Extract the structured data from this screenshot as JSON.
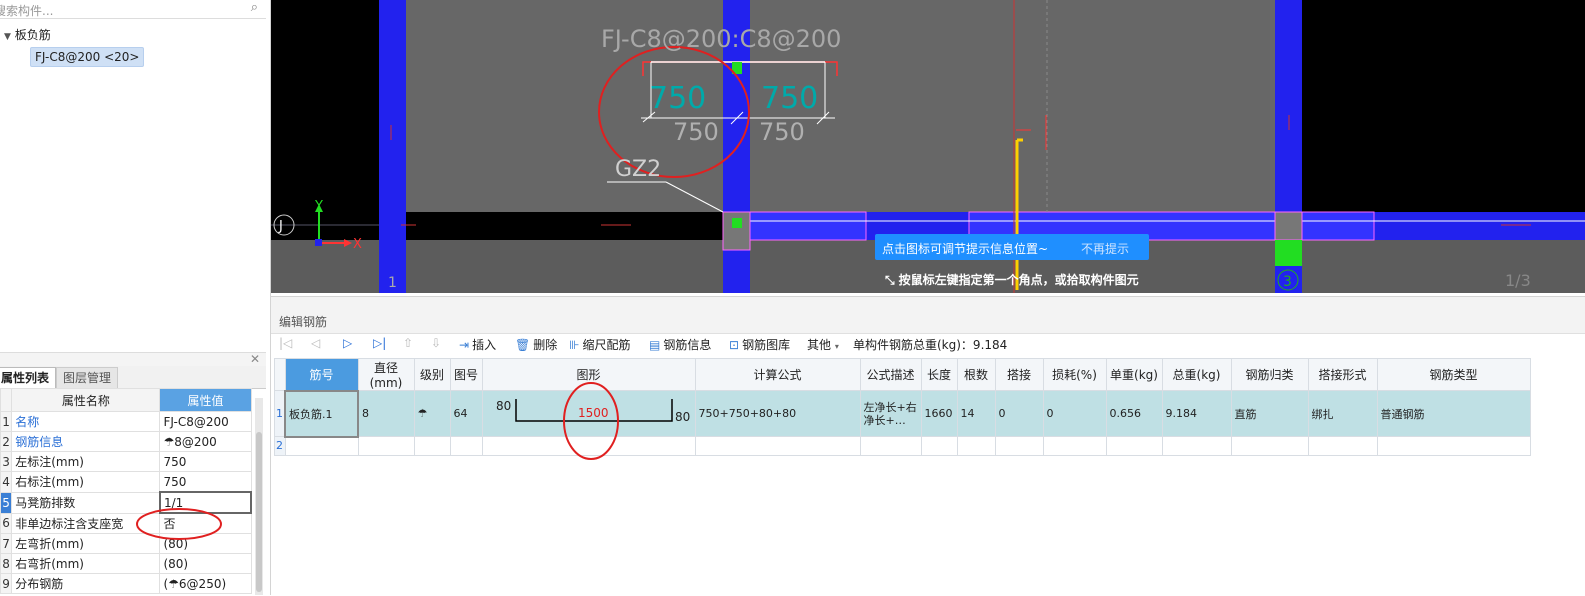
{
  "left_panel": {
    "search": {
      "placeholder": "搜索构件...",
      "icon": "search-icon"
    },
    "tree": {
      "root_label": "板负筋",
      "child_label": "FJ-C8@200 <20>"
    },
    "tabs": [
      "属性列表",
      "图层管理"
    ],
    "property_grid": {
      "headers": [
        "属性名称",
        "属性值"
      ],
      "rows": [
        {
          "num": "1",
          "name": "名称",
          "value": "FJ-C8@200"
        },
        {
          "num": "2",
          "name": "钢筋信息",
          "value": "☂8@200"
        },
        {
          "num": "3",
          "name": "左标注(mm)",
          "value": "750"
        },
        {
          "num": "4",
          "name": "右标注(mm)",
          "value": "750"
        },
        {
          "num": "5",
          "name": "马凳筋排数",
          "value": "1/1"
        },
        {
          "num": "6",
          "name": "非单边标注含支座宽",
          "value": "否"
        },
        {
          "num": "7",
          "name": "左弯折(mm)",
          "value": "(80)"
        },
        {
          "num": "8",
          "name": "右弯折(mm)",
          "value": "(80)"
        },
        {
          "num": "9",
          "name": "分布钢筋",
          "value": "(☂6@250)"
        }
      ]
    }
  },
  "cad": {
    "label_top": "FJ-C8@200:C8@200",
    "dim_left_cyan": "750",
    "dim_right_cyan": "750",
    "dim_left_white": "750",
    "dim_right_white": "750",
    "gz_label": "GZ2",
    "axis_j": "J",
    "axis_x": "X",
    "axis_y": "Y",
    "grid_1": "1",
    "grid_3": "3",
    "page_indicator": "1/3",
    "tip_message": "点击图标可调节提示信息位置~",
    "tip_dismiss": "不再提示",
    "command_prompt": "按鼠标左键指定第一个角点，或拾取构件图元"
  },
  "editor": {
    "title": "编辑钢筋",
    "toolbar": {
      "insert": "插入",
      "delete": "删除",
      "scale": "缩尺配筋",
      "info": "钢筋信息",
      "library": "钢筋图库",
      "other": "其他",
      "total_weight": "单构件钢筋总重(kg)：9.184"
    },
    "columns": [
      "筋号",
      "直径(mm)",
      "级别",
      "图号",
      "图形",
      "计算公式",
      "公式描述",
      "长度",
      "根数",
      "搭接",
      "损耗(%)",
      "单重(kg)",
      "总重(kg)",
      "钢筋归类",
      "搭接形式",
      "钢筋类型"
    ],
    "rows": [
      {
        "num": "1",
        "name": "板负筋.1",
        "diameter": "8",
        "grade": "☂",
        "fig_no": "64",
        "shape_left": "80",
        "shape_mid": "1500",
        "shape_right": "80",
        "formula": "750+750+80+80",
        "desc": "左净长+右净长+…",
        "length": "1660",
        "count": "14",
        "lap": "0",
        "loss": "0",
        "unit_weight": "0.656",
        "total_weight": "9.184",
        "category": "直筋",
        "lap_type": "绑扎",
        "rebar_type": "普通钢筋"
      }
    ],
    "empty_row_num": "2"
  }
}
